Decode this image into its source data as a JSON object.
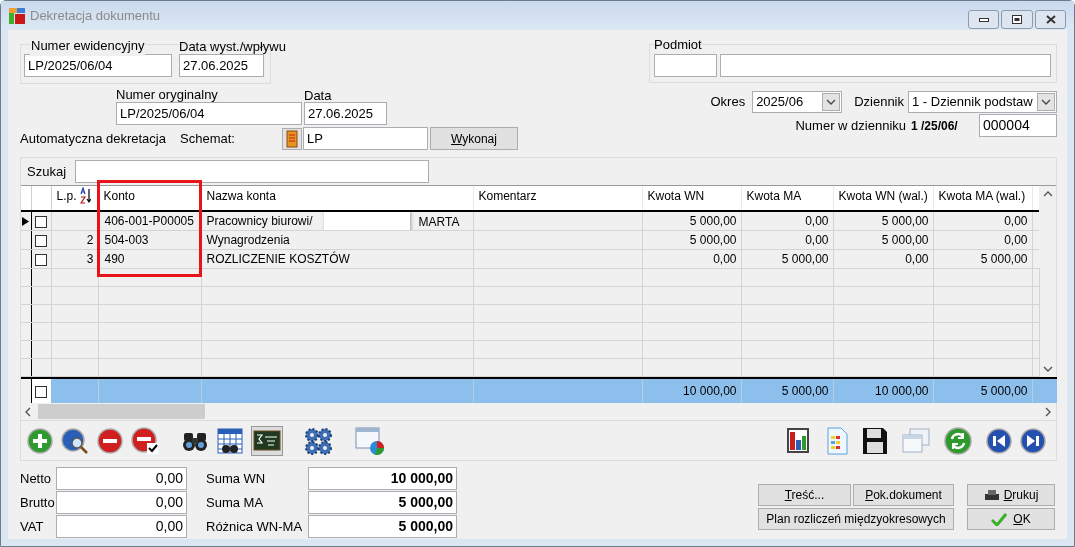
{
  "window": {
    "title": "Dekretacja dokumentu"
  },
  "document": {
    "numer_ewidencyjny": {
      "label": "Numer ewidencyjny",
      "value": "LP/2025/06/04"
    },
    "data_wyst": {
      "label": "Data wyst./wpływu",
      "value": "27.06.2025"
    },
    "numer_oryginalny": {
      "label": "Numer oryginalny",
      "value": "LP/2025/06/04"
    },
    "data": {
      "label": "Data",
      "value": "27.06.2025"
    }
  },
  "auto": {
    "label": "Automatyczna dekretacja",
    "schemat_label": "Schemat:",
    "schemat_value": "LP",
    "button": {
      "label": "Wykonaj",
      "underline_first": true
    }
  },
  "podmiot": {
    "label": "Podmiot"
  },
  "okres": {
    "label": "Okres",
    "value": "2025/06"
  },
  "dziennik": {
    "label": "Dziennik",
    "value": "1  - Dziennik podstaw"
  },
  "numer_w_dzienniku": {
    "label": "Numer w dzienniku",
    "prefix": "1 /25/06/",
    "value": "000004"
  },
  "search": {
    "label": "Szukaj"
  },
  "table": {
    "columns": [
      {
        "label": "L.p.",
        "sorted": true,
        "highlighted": false
      },
      {
        "label": "Konto",
        "sorted": false,
        "highlighted": true
      },
      {
        "label": "Nazwa konta",
        "sorted": false,
        "highlighted": false
      },
      {
        "label": "Komentarz",
        "sorted": false,
        "highlighted": false
      },
      {
        "label": "Kwota WN",
        "sorted": false,
        "highlighted": false
      },
      {
        "label": "Kwota MA",
        "sorted": false,
        "highlighted": false
      },
      {
        "label": "Kwota WN (wal.)",
        "sorted": false,
        "highlighted": false
      },
      {
        "label": "Kwota MA (wal.)",
        "sorted": false,
        "highlighted": false
      }
    ],
    "rows": [
      {
        "current": true,
        "checked": false,
        "konto": "406-001-P00005",
        "nazwa": "Pracownicy biurowi/",
        "redacted": true,
        "nazwa_after": "MARTA",
        "kwota_wn": "5 000,00",
        "kwota_ma": "0,00",
        "kwota_wn_wal": "5 000,00",
        "kwota_ma_wal": "0,00"
      },
      {
        "current": false,
        "checked": false,
        "lp": "2",
        "konto": "504-003",
        "nazwa": "Wynagrodzenia",
        "redacted": false,
        "kwota_wn": "5 000,00",
        "kwota_ma": "0,00",
        "kwota_wn_wal": "5 000,00",
        "kwota_ma_wal": "0,00"
      },
      {
        "current": false,
        "checked": false,
        "lp": "3",
        "konto": "490",
        "nazwa": "ROZLICZENIE KOSZTÓW",
        "redacted": false,
        "kwota_wn": "0,00",
        "kwota_ma": "5 000,00",
        "kwota_wn_wal": "0,00",
        "kwota_ma_wal": "5 000,00"
      }
    ],
    "totals": {
      "checked": false,
      "kwota_wn": "10 000,00",
      "kwota_ma": "5 000,00",
      "kwota_wn_wal": "10 000,00",
      "kwota_ma_wal": "5 000,00"
    }
  },
  "summary_left": [
    {
      "label": "Netto",
      "value": "0,00"
    },
    {
      "label": "Brutto",
      "value": "0,00"
    },
    {
      "label": "VAT",
      "value": "0,00"
    }
  ],
  "summary_right": [
    {
      "label": "Suma WN",
      "value": "10 000,00"
    },
    {
      "label": "Suma MA",
      "value": "5 000,00"
    },
    {
      "label": "Różnica WN-MA",
      "value": "5 000,00"
    }
  ],
  "buttons": [
    {
      "kind": "plain",
      "label": "Treść...",
      "underline_first": true
    },
    {
      "kind": "plain",
      "label": "Pok.dokument",
      "underline_first": true
    },
    {
      "kind": "print",
      "label": "Drukuj",
      "underline_first": true
    },
    {
      "kind": "wide",
      "label": "Plan rozliczeń międzyokresowych",
      "underline_first": false
    },
    {
      "kind": "ok",
      "label": "OK",
      "underline_first": true
    }
  ]
}
